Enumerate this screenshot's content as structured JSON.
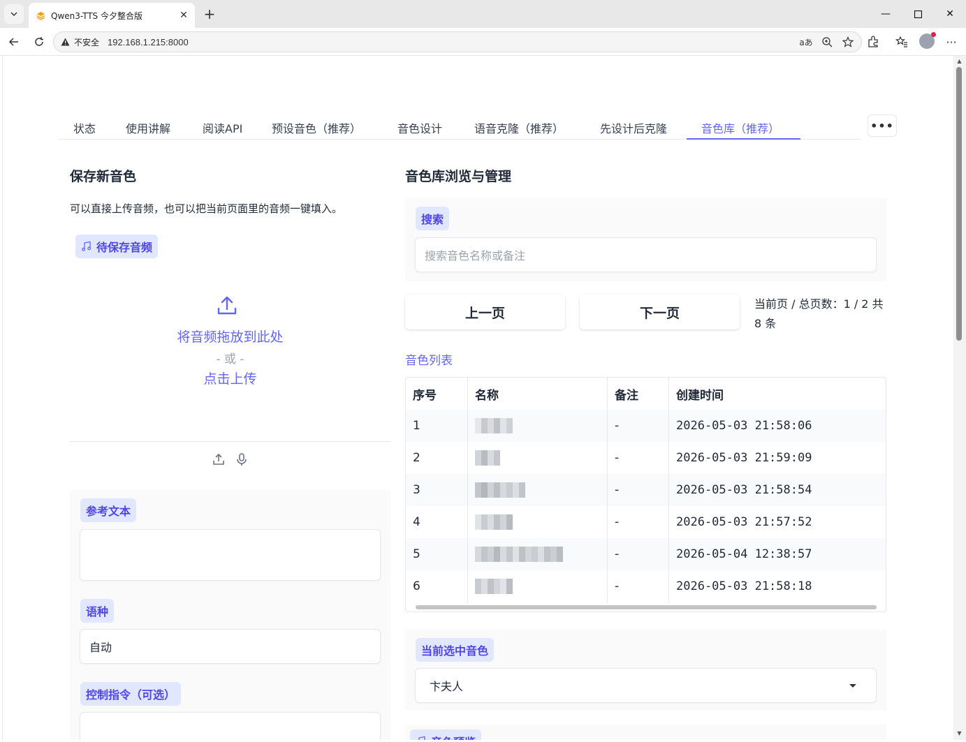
{
  "browser": {
    "tab_title": "Qwen3-TTS 今夕整合版",
    "security_label": "不安全",
    "url": "192.168.1.215:8000"
  },
  "tabs": [
    {
      "label": "状态"
    },
    {
      "label": "使用讲解"
    },
    {
      "label": "阅读API"
    },
    {
      "label": "预设音色（推荐）"
    },
    {
      "label": "音色设计"
    },
    {
      "label": "语音克隆（推荐）"
    },
    {
      "label": "先设计后克隆"
    },
    {
      "label": "音色库（推荐）"
    }
  ],
  "active_tab": "音色库（推荐）",
  "more_label": "•••",
  "left": {
    "title": "保存新音色",
    "description": "可以直接上传音频，也可以把当前页面里的音频一键填入。",
    "audio_label": "待保存音频",
    "drop_text": "将音频拖放到此处",
    "or_text": "- 或 -",
    "click_upload": "点击上传",
    "ref_text_label": "参考文本",
    "ref_text_value": "",
    "language_label": "语种",
    "language_value": "自动",
    "instruction_label": "控制指令（可选）"
  },
  "right": {
    "title": "音色库浏览与管理",
    "search_label": "搜索",
    "search_placeholder": "搜索音色名称或备注",
    "prev_label": "上一页",
    "next_label": "下一页",
    "page_info": "当前页 / 总页数：1 / 2 共 8 条",
    "list_label": "音色列表",
    "columns": [
      "序号",
      "名称",
      "备注",
      "创建时间"
    ],
    "rows": [
      {
        "no": "1",
        "note": "-",
        "time": "2026-05-03 21:58:06"
      },
      {
        "no": "2",
        "note": "-",
        "time": "2026-05-03 21:59:09"
      },
      {
        "no": "3",
        "note": "-",
        "time": "2026-05-03 21:58:54"
      },
      {
        "no": "4",
        "note": "-",
        "time": "2026-05-03 21:57:52"
      },
      {
        "no": "5",
        "note": "-",
        "time": "2026-05-04 12:38:57"
      },
      {
        "no": "6",
        "note": "-",
        "time": "2026-05-03 21:58:18"
      }
    ],
    "selected_label": "当前选中音色",
    "selected_value": "卞夫人",
    "preview_label": "音色预览"
  },
  "colors": {
    "accent": "#6366f1",
    "chip_bg": "#e0e7ff"
  }
}
